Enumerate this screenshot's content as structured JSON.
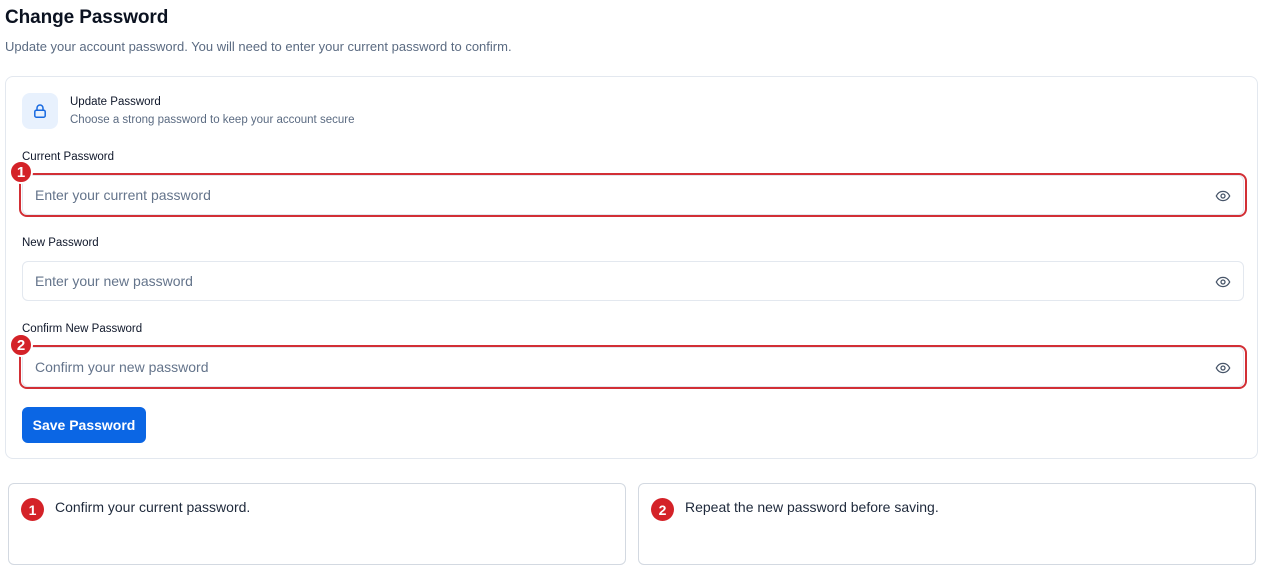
{
  "page": {
    "title": "Change Password",
    "subtitle": "Update your account password. You will need to enter your current password to confirm."
  },
  "card": {
    "icon": "lock-icon",
    "title": "Update Password",
    "description": "Choose a strong password to keep your account secure"
  },
  "fields": {
    "current": {
      "label": "Current Password",
      "placeholder": "Enter your current password",
      "value": "",
      "toggle_icon": "eye-icon"
    },
    "new": {
      "label": "New Password",
      "placeholder": "Enter your new password",
      "value": "",
      "toggle_icon": "eye-icon"
    },
    "confirm": {
      "label": "Confirm New Password",
      "placeholder": "Confirm your new password",
      "value": "",
      "toggle_icon": "eye-icon"
    }
  },
  "save_button": {
    "label": "Save Password"
  },
  "annotations": [
    {
      "number": "1",
      "text": "Confirm your current password."
    },
    {
      "number": "2",
      "text": "Repeat the new password before saving."
    }
  ],
  "colors": {
    "accent": "#0b66e4",
    "annotation_red": "#d42228",
    "icon_bg": "#e8f1fd",
    "border": "#e3e8ef",
    "muted_text": "#5b6b82"
  }
}
